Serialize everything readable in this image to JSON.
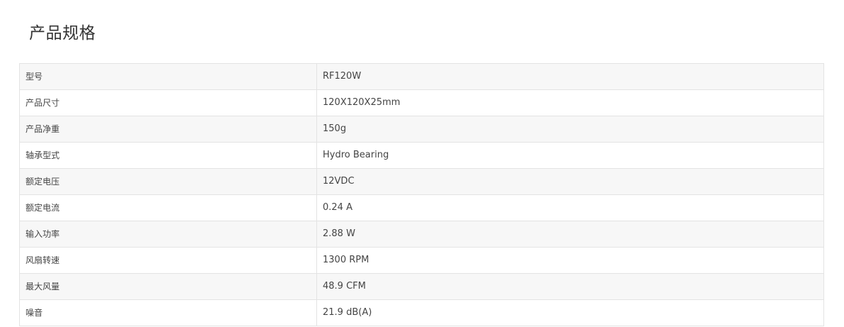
{
  "page": {
    "title": "产品规格"
  },
  "specs": [
    {
      "label": "型号",
      "value": "RF120W"
    },
    {
      "label": "产品尺寸",
      "value": "120X120X25mm"
    },
    {
      "label": "产品净重",
      "value": "150g"
    },
    {
      "label": "轴承型式",
      "value": "Hydro Bearing"
    },
    {
      "label": "额定电压",
      "value": "12VDC"
    },
    {
      "label": "额定电流",
      "value": "0.24 A"
    },
    {
      "label": "输入功率",
      "value": "2.88 W"
    },
    {
      "label": "风扇转速",
      "value": "1300 RPM"
    },
    {
      "label": "最大风量",
      "value": "48.9 CFM"
    },
    {
      "label": "噪音",
      "value": "21.9 dB(A)"
    }
  ]
}
